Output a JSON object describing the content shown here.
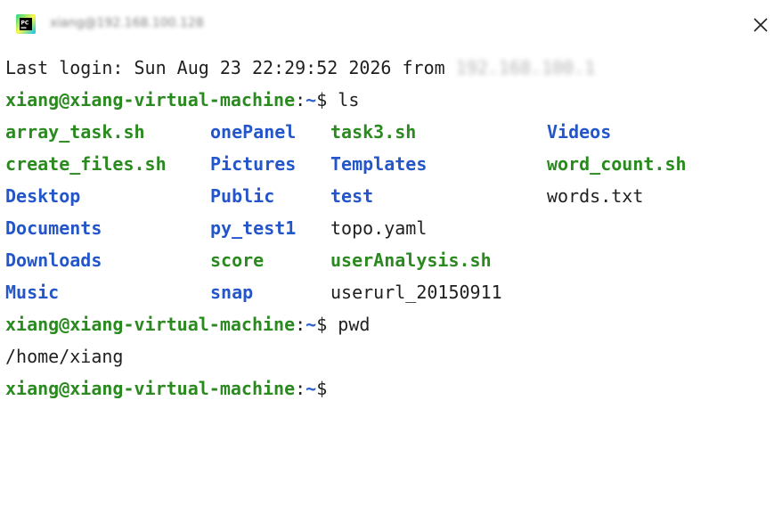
{
  "window": {
    "title": "xiang@192.168.100.128",
    "close_symbol": "✕"
  },
  "terminal": {
    "last_login_label": "Last login: Sun Aug 23 22:29:52 2026 from",
    "last_login_host": "192.168.100.1",
    "prompt_user_host": "xiang@xiang-virtual-machine",
    "prompt_path": "~",
    "prompt_suffix": "$",
    "commands": [
      "ls",
      "pwd",
      ""
    ],
    "pwd_output": "/home/xiang",
    "ls_entries": [
      {
        "name": "array_task.sh",
        "type": "exec"
      },
      {
        "name": "create_files.sh",
        "type": "exec"
      },
      {
        "name": "Desktop",
        "type": "dir"
      },
      {
        "name": "Documents",
        "type": "dir"
      },
      {
        "name": "Downloads",
        "type": "dir"
      },
      {
        "name": "Music",
        "type": "dir"
      },
      {
        "name": "onePanel",
        "type": "dir"
      },
      {
        "name": "Pictures",
        "type": "dir"
      },
      {
        "name": "Public",
        "type": "dir"
      },
      {
        "name": "py_test1",
        "type": "dir"
      },
      {
        "name": "score",
        "type": "exec"
      },
      {
        "name": "snap",
        "type": "dir"
      },
      {
        "name": "task3.sh",
        "type": "exec"
      },
      {
        "name": "Templates",
        "type": "dir"
      },
      {
        "name": "test",
        "type": "dir"
      },
      {
        "name": "topo.yaml",
        "type": "file"
      },
      {
        "name": "userAnalysis.sh",
        "type": "exec"
      },
      {
        "name": "userurl_20150911",
        "type": "file"
      },
      {
        "name": "Videos",
        "type": "dir"
      },
      {
        "name": "word_count.sh",
        "type": "exec"
      },
      {
        "name": "words.txt",
        "type": "file"
      }
    ]
  },
  "colors": {
    "prompt_user": "#2a8a1f",
    "prompt_path": "#2a5fd1",
    "dir": "#2456c9",
    "exec": "#2a8a1f",
    "text": "#1f1f1f"
  },
  "icons": {
    "app": "pycharm-icon",
    "close": "close-icon"
  }
}
